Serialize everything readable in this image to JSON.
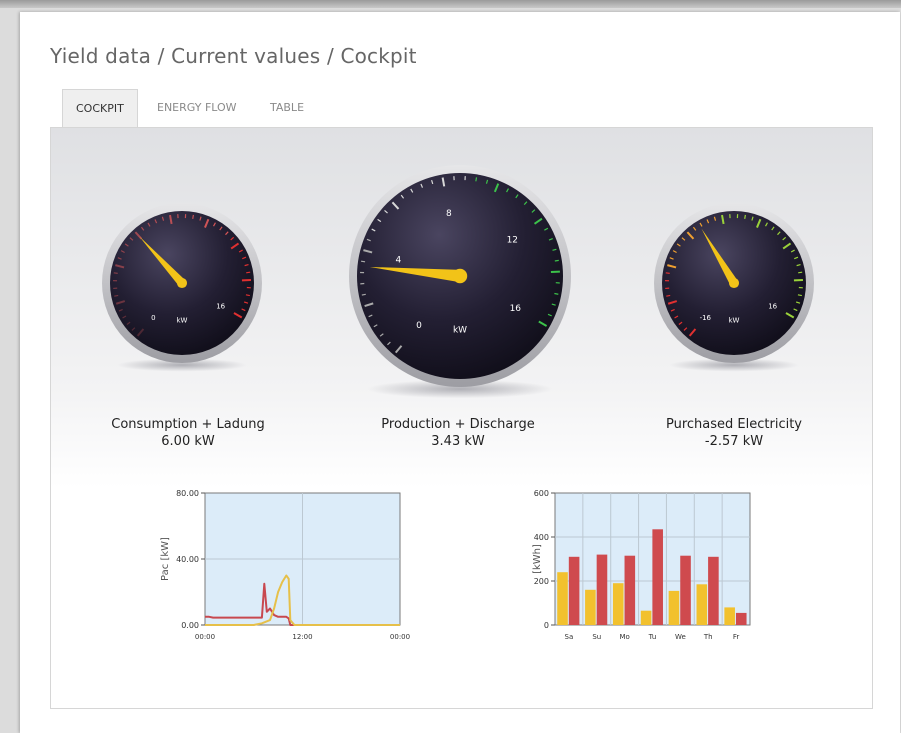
{
  "breadcrumb": "Yield data / Current values / Cockpit",
  "tabs": [
    {
      "label": "COCKPIT",
      "active": true
    },
    {
      "label": "ENERGY FLOW",
      "active": false
    },
    {
      "label": "TABLE",
      "active": false
    }
  ],
  "gauges": [
    {
      "label": "Consumption + Ladung",
      "value_text": "6.00 kW",
      "value": 6.0,
      "unit": "kW",
      "ticks": [
        "0",
        "16"
      ],
      "min": 0,
      "max": 16,
      "accent": "#e03030"
    },
    {
      "label": "Production + Discharge",
      "value_text": "3.43 kW",
      "value": 3.43,
      "unit": "kW",
      "ticks": [
        "0",
        "4",
        "8",
        "12",
        "16"
      ],
      "min": 0,
      "max": 16,
      "accent": "#3cc24a"
    },
    {
      "label": "Purchased Electricity",
      "value_text": "-2.57 kW",
      "value": -2.57,
      "unit": "kW",
      "ticks": [
        "-16",
        "16"
      ],
      "min": -16,
      "max": 16,
      "accent": "#e03030"
    }
  ],
  "chart_data": [
    {
      "type": "line",
      "ylabel": "Pac [kW]",
      "ylim": [
        0,
        80
      ],
      "yticks": [
        "0.00",
        "40.00",
        "80.00"
      ],
      "xticks": [
        "00:00",
        "12:00",
        "00:00"
      ],
      "grid": true,
      "series": [
        {
          "color": "#c8484f",
          "x": [
            0,
            0.5,
            1,
            2,
            3,
            4,
            5,
            6,
            6.5,
            7,
            7.3,
            7.6,
            8,
            8.5,
            9,
            9.5,
            10,
            10.3,
            10.5,
            11,
            12,
            16,
            20,
            24
          ],
          "y": [
            5,
            5,
            4.5,
            4.5,
            4.5,
            4.5,
            4.5,
            4.5,
            4.5,
            4.5,
            25,
            8,
            10,
            6,
            5,
            5,
            5,
            4,
            0,
            0,
            0,
            0,
            0,
            0
          ]
        },
        {
          "color": "#e6c04a",
          "x": [
            0,
            6,
            7,
            8,
            8.5,
            9,
            9.5,
            10,
            10.3,
            10.5,
            11,
            12,
            24
          ],
          "y": [
            0,
            0,
            1,
            3,
            10,
            20,
            26,
            30,
            28,
            3,
            0,
            0,
            0
          ]
        }
      ]
    },
    {
      "type": "bar",
      "ylabel": "[kWh]",
      "ylim": [
        0,
        600
      ],
      "yticks": [
        "0",
        "200",
        "400",
        "600"
      ],
      "categories": [
        "Sa",
        "Su",
        "Mo",
        "Tu",
        "We",
        "Th",
        "Fr"
      ],
      "grid": true,
      "series": [
        {
          "color": "#f2c12e",
          "values": [
            240,
            160,
            190,
            65,
            155,
            185,
            80
          ]
        },
        {
          "color": "#cf4a4e",
          "values": [
            310,
            320,
            315,
            435,
            315,
            310,
            55
          ]
        }
      ]
    }
  ]
}
